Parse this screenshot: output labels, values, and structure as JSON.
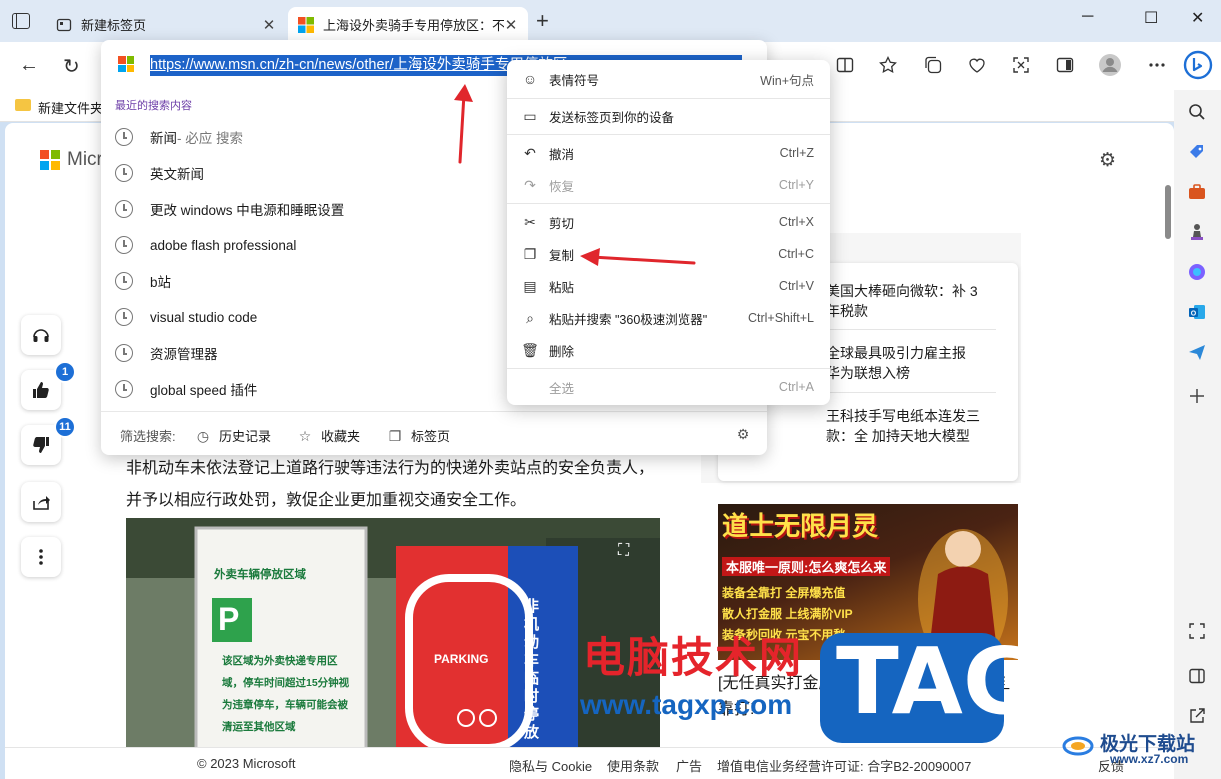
{
  "tabs": [
    {
      "label": "新建标签页",
      "active": false
    },
    {
      "label": "上海设外卖骑手专用停放区：不再",
      "active": true
    }
  ],
  "address": {
    "url": "https://www.msn.cn/zh-cn/news/other/上海设外卖骑手专用停放区"
  },
  "favorites_bar": {
    "folder": "新建文件夹"
  },
  "suggestions": {
    "section_title": "最近的搜索内容",
    "items": [
      {
        "text": "新闻",
        "sub": " - 必应 搜索"
      },
      {
        "text": "英文新闻",
        "sub": ""
      },
      {
        "text": "更改 windows 中电源和睡眠设置",
        "sub": ""
      },
      {
        "text": "adobe flash professional",
        "sub": ""
      },
      {
        "text": "b站",
        "sub": ""
      },
      {
        "text": "visual studio code",
        "sub": ""
      },
      {
        "text": "资源管理器",
        "sub": ""
      },
      {
        "text": "global speed 插件",
        "sub": ""
      }
    ],
    "filter_label": "筛选搜索:",
    "filters": [
      "历史记录",
      "收藏夹",
      "标签页"
    ]
  },
  "context_menu": [
    {
      "label": "表情符号",
      "shortcut": "Win+句点",
      "icon": "emoji-icon",
      "glyph": "☺",
      "disabled": false
    },
    {
      "label": "发送标签页到你的设备",
      "shortcut": "",
      "icon": "devices-icon",
      "glyph": "▭",
      "disabled": false
    },
    {
      "label": "撤消",
      "shortcut": "Ctrl+Z",
      "icon": "undo-icon",
      "glyph": "↶",
      "disabled": false
    },
    {
      "label": "恢复",
      "shortcut": "Ctrl+Y",
      "icon": "redo-icon",
      "glyph": "↷",
      "disabled": true
    },
    {
      "label": "剪切",
      "shortcut": "Ctrl+X",
      "icon": "scissors-icon",
      "glyph": "✂",
      "disabled": false
    },
    {
      "label": "复制",
      "shortcut": "Ctrl+C",
      "icon": "copy-icon",
      "glyph": "❐",
      "disabled": false
    },
    {
      "label": "粘贴",
      "shortcut": "Ctrl+V",
      "icon": "paste-icon",
      "glyph": "▤",
      "disabled": false
    },
    {
      "label": "粘贴并搜索 \"360极速浏览器\"",
      "shortcut": "Ctrl+Shift+L",
      "icon": "paste-search-icon",
      "glyph": "⌕",
      "disabled": false
    },
    {
      "label": "删除",
      "shortcut": "",
      "icon": "trash-icon",
      "glyph": "🗑",
      "disabled": false
    },
    {
      "label": "全选",
      "shortcut": "Ctrl+A",
      "icon": "",
      "glyph": "",
      "disabled": true
    }
  ],
  "page": {
    "brand": "Micro",
    "likes": "1",
    "dislikes": "11",
    "article_text": "非机动车未依法登记上道路行驶等违法行为的快递外卖站点的安全负责人，并予以相应行政处罚，敦促企业更加重视交通安全工作。",
    "photo_sign_title": "外卖车辆停放区域",
    "photo_sign_body": "该区域为外卖快递专用区域，停车时间超过15分钟视为违章停车，车辆可能会被清运至其他区域",
    "photo_parking": "PARKING",
    "photo_vertical": "非机动车临时停放",
    "news_items": [
      "美国大棒砸向微软：补 3年税款",
      "全球最具吸引力雇主报 华为联想入榜",
      "王科技手写电纸本连发三款：全 加持天地大模型"
    ],
    "ad_title": "道士无限月灵",
    "ad_sub": "本服唯一原则:怎么爽怎么来",
    "ad_lines": [
      "装备全靠打 全屏爆充值",
      "散人打金服 上线满阶VIP",
      "装备秒回收 元宝不用愁"
    ],
    "caption2": "[无任真实打金服，道士无限月灵，装备全靠打!",
    "footer": {
      "copyright": "© 2023 Microsoft",
      "links": [
        "隐私与 Cookie",
        "使用条款",
        "广告",
        "增值电信业务经营许可证: 合字B2-20090007"
      ],
      "feedback": "反馈"
    }
  },
  "watermarks": {
    "main": "电脑技术网",
    "url": "www.tagxp.com",
    "tag": "TAG",
    "site": "极光下载站",
    "site_url": "www.xz7.com"
  },
  "colors": {
    "selection": "#1d63c8",
    "arrow": "#e0262c",
    "accent": "#1d6fd6"
  }
}
